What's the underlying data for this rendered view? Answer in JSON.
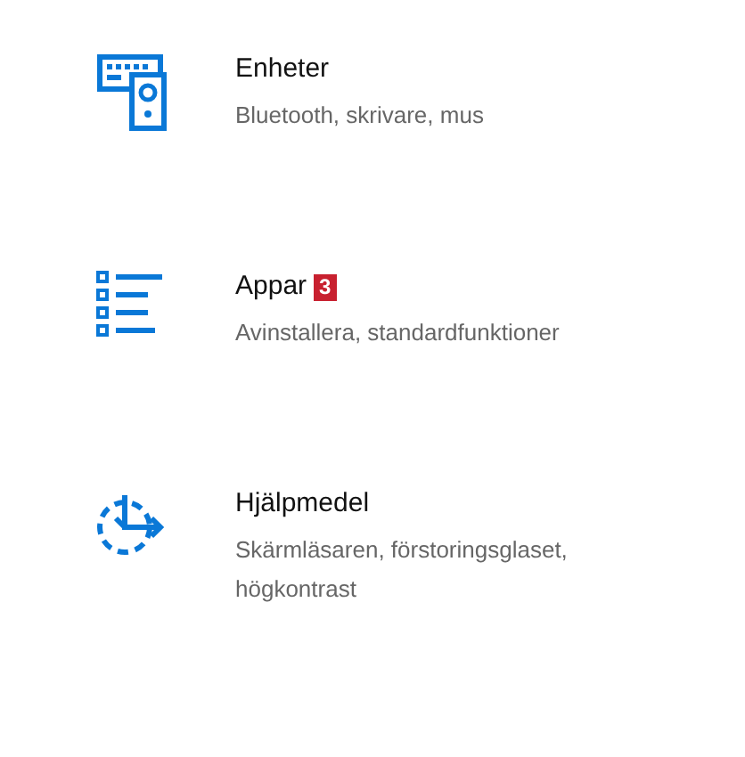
{
  "items": [
    {
      "kind": "devices",
      "title": "Enheter",
      "description": "Bluetooth, skrivare, mus"
    },
    {
      "kind": "apps",
      "title": "Appar",
      "badge": "3",
      "description": "Avinstallera, standardfunktioner"
    },
    {
      "kind": "accessibility",
      "title": "Hjälpmedel",
      "description": "Skärmläsaren, förstoringsglaset, högkontrast"
    }
  ]
}
